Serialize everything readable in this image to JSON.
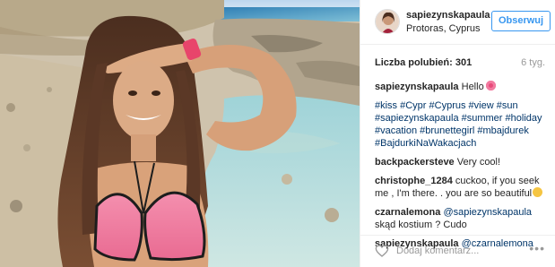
{
  "post": {
    "username": "sapiezynskapaula",
    "location": "Protoras, Cyprus",
    "follow_label": "Obserwuj",
    "likes_label": "Liczba polubień: 301",
    "age": "6 tyg."
  },
  "caption": {
    "user": "sapiezynskapaula",
    "text": "Hello",
    "hashtags": "#kiss #Cypr #Cyprus #view #sun #sapiezynskapaula #summer #holiday #vacation #brunettegirl #mbajdurek #BajdurkiNaWakacjach"
  },
  "comments": [
    {
      "user": "backpackersteve",
      "text": "Very cool!"
    },
    {
      "user": "christophe_1284",
      "text": "cuckoo, if you seek me , I'm there. . you are so beautiful"
    },
    {
      "user": "czarnalemona",
      "mention": "@sapiezynskapaula",
      "text": "skąd kostium ? Cudo"
    },
    {
      "user": "sapiezynskapaula",
      "mention": "@czarnalemona",
      "text": ""
    }
  ],
  "footer": {
    "comment_placeholder": "Dodaj komentarz...",
    "more": "•••"
  },
  "icons": {
    "heart": "heart-icon",
    "more": "more-options-icon"
  },
  "colors": {
    "accent": "#3897f0",
    "hashtag": "#003569",
    "muted": "#999999"
  }
}
